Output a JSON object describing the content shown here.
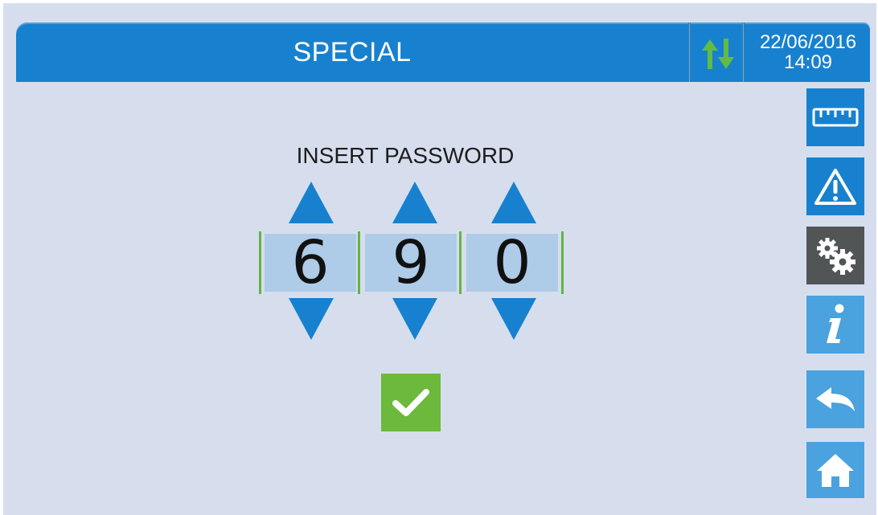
{
  "header": {
    "title": "SPECIAL",
    "communication_icon": "up-down-arrows-icon",
    "date": "22/06/2016",
    "time": "14:09"
  },
  "password": {
    "prompt": "INSERT PASSWORD",
    "digits": [
      "6",
      "9",
      "0"
    ],
    "increment_icon": "triangle-up-icon",
    "decrement_icon": "triangle-down-icon",
    "confirm_icon": "checkmark-icon"
  },
  "sidebar": {
    "items": [
      {
        "icon": "ruler-icon",
        "state": "normal"
      },
      {
        "icon": "warning-icon",
        "state": "normal"
      },
      {
        "icon": "gears-icon",
        "state": "active"
      },
      {
        "icon": "info-icon",
        "state": "normal"
      },
      {
        "icon": "back-arrow-icon",
        "state": "normal"
      },
      {
        "icon": "home-icon",
        "state": "normal"
      }
    ]
  },
  "colors": {
    "background": "#d6deee",
    "header_blue": "#1781cf",
    "digit_box": "#aecbe7",
    "confirm_green": "#6cb93c",
    "active_sidebar": "#525556",
    "comm_icon_green": "#62bb46"
  }
}
